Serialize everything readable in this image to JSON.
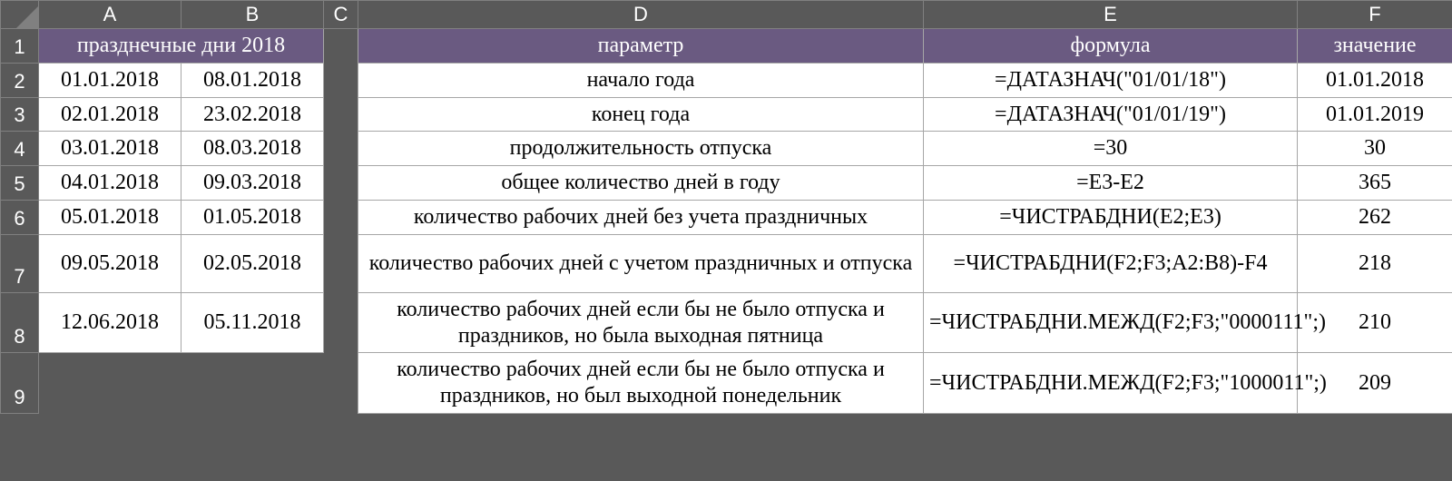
{
  "columns": [
    "A",
    "B",
    "C",
    "D",
    "E",
    "F"
  ],
  "row_numbers": [
    "1",
    "2",
    "3",
    "4",
    "5",
    "6",
    "7",
    "8",
    "9"
  ],
  "header_ab": "празднечные дни 2018",
  "header_d": "параметр",
  "header_e": "формула",
  "header_f": "значение",
  "holidays": [
    {
      "a": "01.01.2018",
      "b": "08.01.2018"
    },
    {
      "a": "02.01.2018",
      "b": "23.02.2018"
    },
    {
      "a": "03.01.2018",
      "b": "08.03.2018"
    },
    {
      "a": "04.01.2018",
      "b": "09.03.2018"
    },
    {
      "a": "05.01.2018",
      "b": "01.05.2018"
    },
    {
      "a": "09.05.2018",
      "b": "02.05.2018"
    },
    {
      "a": "12.06.2018",
      "b": "05.11.2018"
    }
  ],
  "params": [
    {
      "d": "начало года",
      "e": "=ДАТАЗНАЧ(\"01/01/18\")",
      "f": "01.01.2018"
    },
    {
      "d": "конец года",
      "e": "=ДАТАЗНАЧ(\"01/01/19\")",
      "f": "01.01.2019"
    },
    {
      "d": "продолжительность отпуска",
      "e": "=30",
      "f": "30"
    },
    {
      "d": "общее количество дней в году",
      "e": "=E3-E2",
      "f": "365"
    },
    {
      "d": "количество рабочих дней без учета праздничных",
      "e": "=ЧИСТРАБДНИ(E2;E3)",
      "f": "262"
    },
    {
      "d": "количество рабочих дней с учетом праздничных и отпуска",
      "e": "=ЧИСТРАБДНИ(F2;F3;A2:B8)-F4",
      "f": "218"
    },
    {
      "d": "количество рабочих дней если бы не было отпуска и праздников, но была выходная пятница",
      "e": "=ЧИСТРАБДНИ.МЕЖД(F2;F3;\"0000111\";)",
      "f": "210"
    },
    {
      "d": "количество рабочих дней если бы не было отпуска и праздников, но был выходной понедельник",
      "e": "=ЧИСТРАБДНИ.МЕЖД(F2;F3;\"1000011\";)",
      "f": "209"
    }
  ]
}
